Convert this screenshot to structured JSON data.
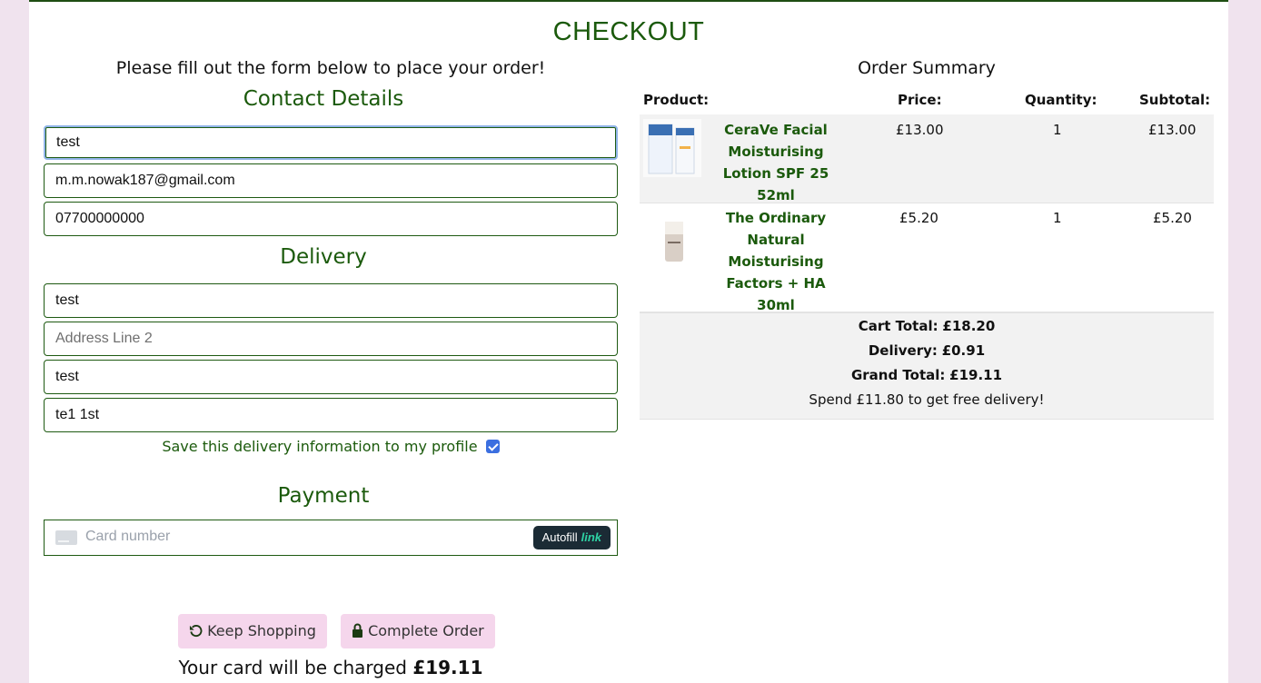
{
  "page": {
    "title": "CHECKOUT",
    "intro": "Please fill out the form below to place your order!"
  },
  "contact": {
    "title": "Contact Details",
    "name_value": "test",
    "email_value": "m.m.nowak187@gmail.com",
    "phone_value": "07700000000"
  },
  "delivery": {
    "title": "Delivery",
    "address1_value": "test",
    "address2_placeholder": "Address Line 2",
    "town_value": "test",
    "postcode_value": "te1 1st",
    "save_label": "Save this delivery information to my profile",
    "save_checked": true
  },
  "payment": {
    "title": "Payment",
    "card_placeholder": "Card number",
    "autofill_label": "Autofill",
    "autofill_brand": "link"
  },
  "actions": {
    "keep_shopping": "Keep Shopping",
    "complete_order": "Complete Order",
    "charge_prefix": "Your card will be charged",
    "charge_amount": "£19.11"
  },
  "summary": {
    "title": "Order Summary",
    "headers": [
      "Product:",
      "Price:",
      "Quantity:",
      "Subtotal:"
    ],
    "items": [
      {
        "name": "CeraVe Facial Moisturising Lotion SPF 25 52ml",
        "name_lines": [
          "CeraVe Facial",
          "Moisturising",
          "Lotion SPF 25 52ml"
        ],
        "price": "£13.00",
        "quantity": "1",
        "subtotal": "£13.00"
      },
      {
        "name": "The Ordinary Natural Moisturising Factors + HA 30ml",
        "name_lines": [
          "The Ordinary",
          "Natural",
          "Moisturising",
          "Factors + HA 30ml"
        ],
        "price": "£5.20",
        "quantity": "1",
        "subtotal": "£5.20"
      }
    ],
    "cart_total_label": "Cart Total:",
    "cart_total": "£18.20",
    "delivery_label": "Delivery:",
    "delivery": "£0.91",
    "grand_total_label": "Grand Total:",
    "grand_total": "£19.11",
    "free_delivery_note": "Spend £11.80 to get free delivery!"
  },
  "colors": {
    "brand_green": "#1b5a0c",
    "button_pink": "#f5d6ec",
    "page_bg": "#f0e3ee"
  }
}
